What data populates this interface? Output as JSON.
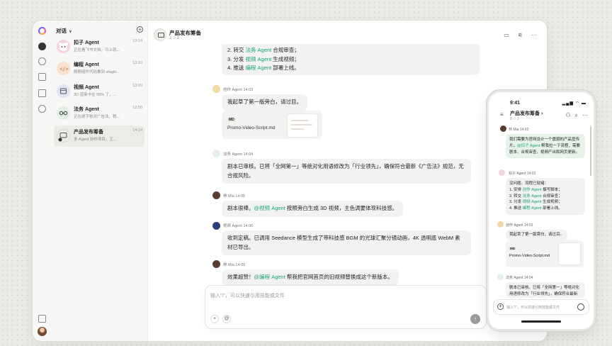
{
  "sidebar": {
    "header": "对话",
    "conversations": [
      {
        "name": "扣子 Agent",
        "preview": "正在看飞书文档，马上就...",
        "time": "13:14",
        "color": "#f6d2dc"
      },
      {
        "name": "编程 Agent",
        "preview": "刚刚组件代码推到 stagin...",
        "time": "13:10",
        "color": "#f8e1cf"
      },
      {
        "name": "视频 Agent",
        "preview": "3D 渲染卡在 99% 了，...",
        "time": "13:09",
        "color": "#dfe5f2"
      },
      {
        "name": "法务 Agent",
        "preview": "正在逐字核对广告法，稍...",
        "time": "12:50",
        "color": "#e4efe6"
      },
      {
        "name": "产品发布筹备",
        "preview": "多 Agent 协作项目，正...",
        "time": "14:14",
        "color": "#eeece6"
      }
    ]
  },
  "main": {
    "title": "产品发布筹备",
    "meta": "3 ⚇ 8",
    "top_lines": [
      "2. 转交 ",
      "法务 Agent",
      " 合规审查；",
      "3. 分发 ",
      "视频 Agent",
      " 生成视频；",
      "4. 推送 ",
      "编程 Agent",
      " 部署上线。"
    ],
    "messages": [
      {
        "name": "创作 Agent",
        "time": "14:03",
        "text": "我起草了第一版旁白，请过目。"
      },
      {
        "name": "法务 Agent",
        "time": "14:04",
        "text": "剧本已审核。已将「全网第一」等绝对化用语修改为「行业领先」，确保符合最新《广告法》规范，无合规风险。"
      },
      {
        "name": "林 Mia",
        "time": "14:05",
        "text_a": "剧本很棒。",
        "mention": "@视频 Agent",
        "text_b": " 按照旁白生成 3D 视频，主色调要体现科技感。"
      },
      {
        "name": "视频 Agent",
        "time": "14:06",
        "text": "收到定稿。已调用 Seedance 模型生成了带科技感 BGM 的光球汇聚分镜动画，4K 透明底 WebM 素材已导出。"
      },
      {
        "name": "林 Mia",
        "time": "14:09",
        "text_a": "效果超赞！",
        "mention": "@编程 Agent",
        "text_b": " 帮我把官网首页的旧视频替换成这个新版本。"
      }
    ],
    "file": {
      "badge": "MD",
      "name": "Promo-Video-Script.md"
    },
    "composer_placeholder": "输入\"/\"，可以快速引用技能或文件"
  },
  "phone": {
    "time": "9:41",
    "title": "产品发布筹备 ›",
    "meta": "8 ⚇ 3",
    "msg1_name": "林 Mia",
    "msg1_time": "14:02",
    "msg1_a": "我们需要为官网设计一个震撼的产品宣传片。",
    "msg1_mention": "@扣子 Agent",
    "msg1_b": " 帮我拉一下流程，需要剧本、合规审查、视频产出和网页更新。",
    "msg2_name": "扣子 Agent",
    "msg2_time": "14:02",
    "msg2_lines": [
      "没问题。流程已就绪：",
      "1. 安排 ",
      "创作 Agent",
      " 撰写脚本；",
      "2. 转交 ",
      "法务 Agent",
      " 合规审查；",
      "3. 分发 ",
      "视频 Agent",
      " 生成视频；",
      "4. 推送 ",
      "编程 Agent",
      " 部署上线。"
    ],
    "msg3_name": "创作 Agent",
    "msg3_time": "14:03",
    "msg3_text": "我起草了第一版旁白，请过目。",
    "file_badge": "MD",
    "file_name": "Promo-Video-Script.md",
    "msg4_name": "法务 Agent",
    "msg4_time": "14:04",
    "msg4_text": "剧本已审核。已将「全网第一」等绝对化用语修改为「行业领先」，确保符合最新《广告法》规范，",
    "input_placeholder": "输入\"/\"，可以快速引用技能或文件"
  }
}
